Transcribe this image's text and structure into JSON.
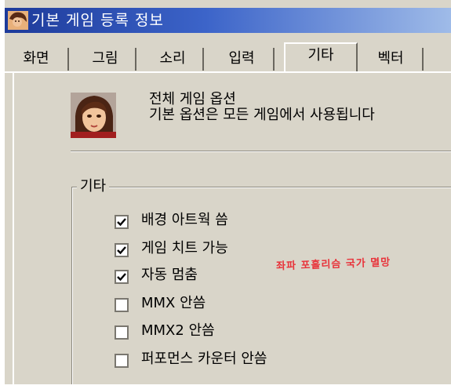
{
  "window": {
    "title": "기본 게임 등록 정보",
    "app_icon": "character-portrait-icon"
  },
  "tabs": [
    {
      "label": "화면",
      "active": false
    },
    {
      "label": "그림",
      "active": false
    },
    {
      "label": "소리",
      "active": false
    },
    {
      "label": "입력",
      "active": false
    },
    {
      "label": "기타",
      "active": true
    },
    {
      "label": "벡터",
      "active": false
    }
  ],
  "header": {
    "title": "전체 게임 옵션",
    "description": "기본 옵션은 모든 게임에서 사용됩니다",
    "avatar_icon": "character-portrait-icon"
  },
  "misc_group": {
    "label": "기타",
    "options": [
      {
        "label": "배경 아트웍 씀",
        "checked": true
      },
      {
        "label": "게임 치트 가능",
        "checked": true
      },
      {
        "label": "자동 멈춤",
        "checked": true
      },
      {
        "label": "MMX 안씀",
        "checked": false
      },
      {
        "label": "MMX2 안씀",
        "checked": false
      },
      {
        "label": "퍼포먼스 카운터 안씀",
        "checked": false
      }
    ]
  },
  "annotation": {
    "text": "좌파 포흘리슴 국가 멸망"
  },
  "colors": {
    "dialog_bg": "#d9d5c9",
    "titlebar_start": "#1d3a9a",
    "titlebar_end": "#9fbbe8",
    "annotation": "#e8333a"
  }
}
